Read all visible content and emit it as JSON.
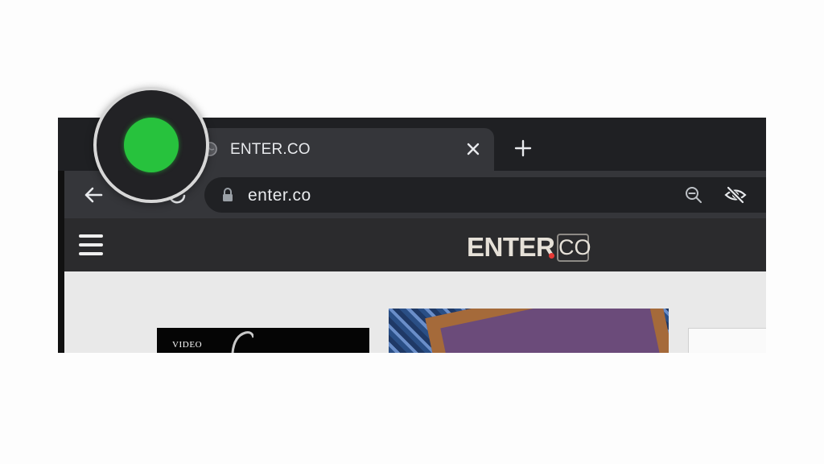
{
  "browser": {
    "tab": {
      "title": "ENTER.CO",
      "favicon": "globe-icon",
      "close_icon": "close-icon"
    },
    "new_tab_icon": "plus-icon",
    "toolbar": {
      "back_icon": "arrow-left-icon",
      "reload_icon": "reload-icon",
      "lock_icon": "lock-icon",
      "url": "enter.co",
      "zoom_icon": "zoom-out-icon",
      "tracking_icon": "eye-slash-icon"
    },
    "magnified_button": {
      "icon": "fullscreen-traffic-light",
      "color": "#27c23d"
    }
  },
  "site": {
    "menu_icon": "hamburger-icon",
    "logo": {
      "main": "ENTER",
      "suffix": "CO",
      "dot_color": "#e53935"
    },
    "cards": [
      {
        "label": "VIDEO"
      }
    ]
  }
}
